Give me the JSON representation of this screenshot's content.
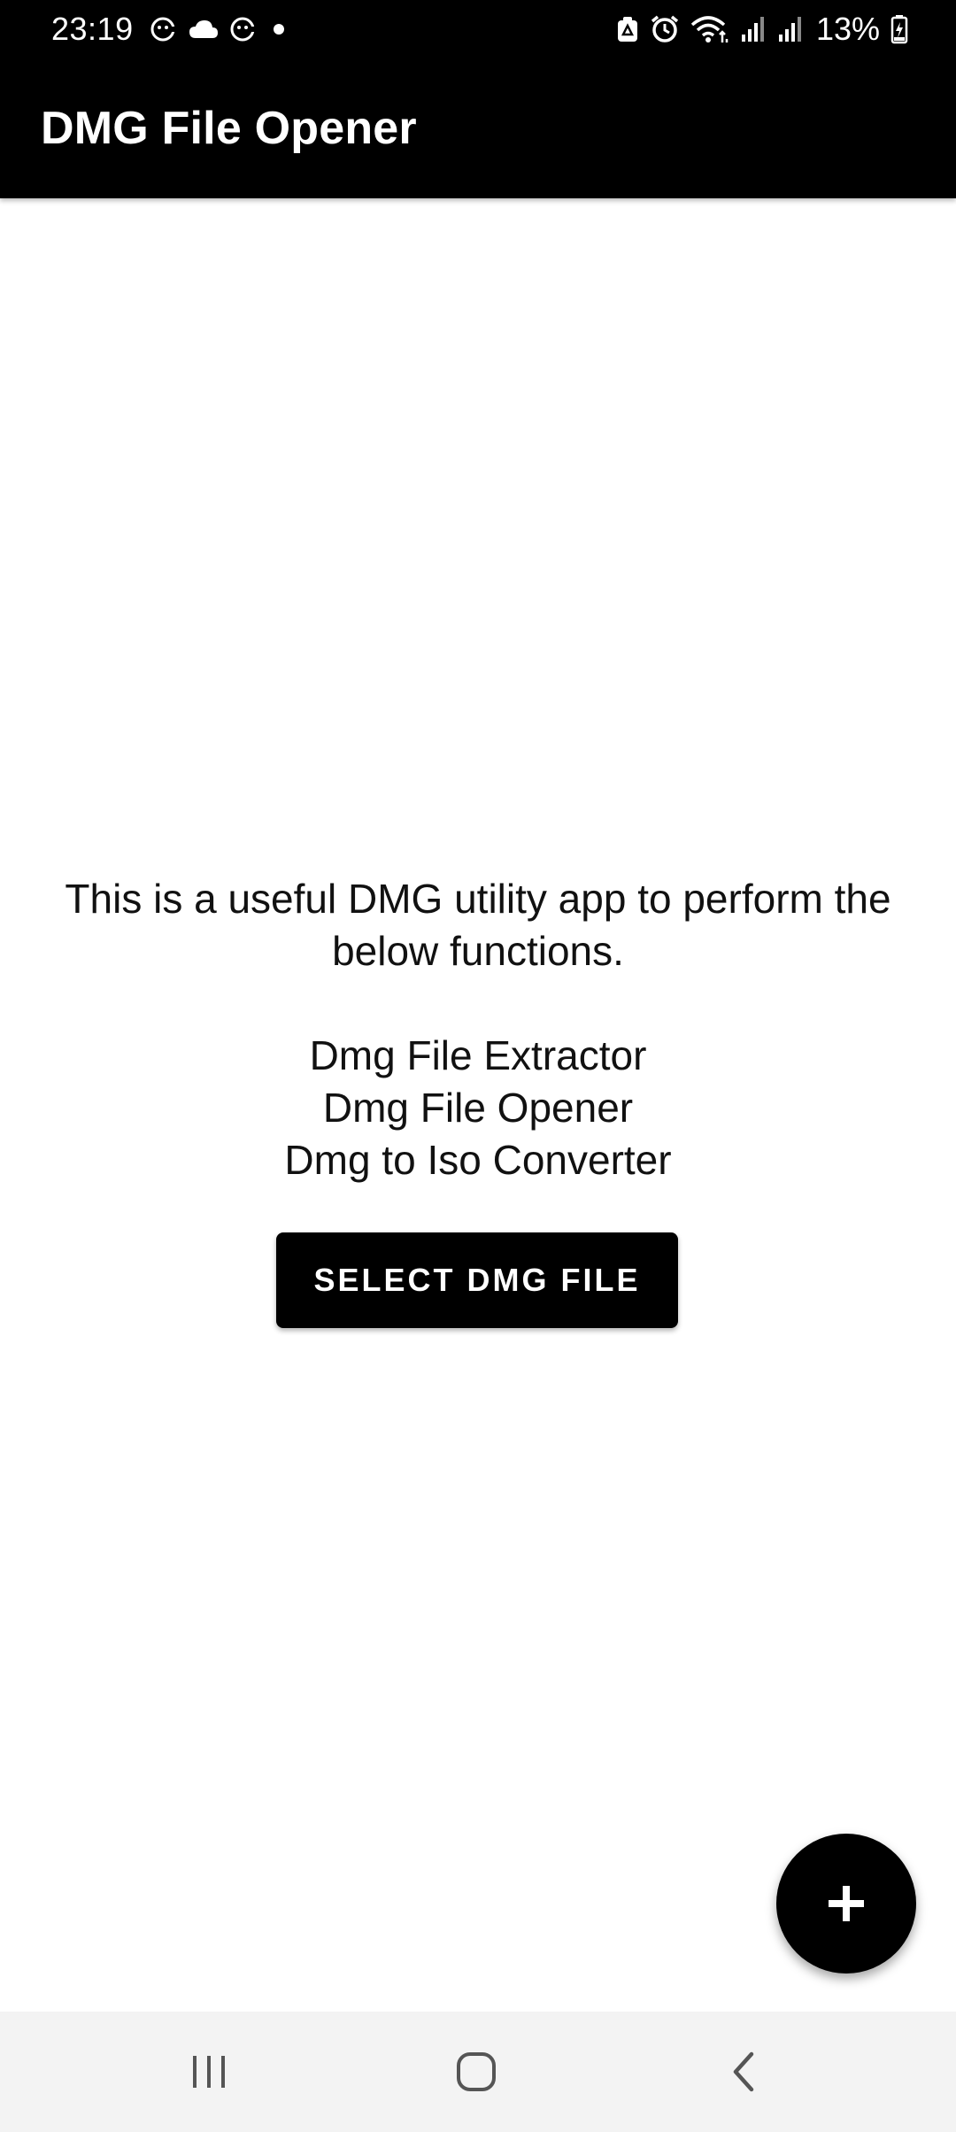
{
  "status_bar": {
    "time": "23:19",
    "battery": "13%",
    "left_icons": [
      "face-icon",
      "cloud-icon",
      "face-icon",
      "dot-icon"
    ],
    "right_icons": [
      "recycle-icon",
      "alarm-icon",
      "wifi-icon",
      "signal-icon",
      "signal-icon",
      "battery-charging-icon"
    ]
  },
  "app_bar": {
    "title": "DMG File Opener"
  },
  "main": {
    "intro": "This is a useful DMG utility app to perform the below functions.",
    "features": [
      "Dmg File Extractor",
      "Dmg File Opener",
      "Dmg to Iso Converter"
    ],
    "select_button_label": "SELECT DMG FILE"
  },
  "fab": {
    "icon": "plus-icon"
  },
  "nav_bar": {
    "buttons": [
      "recents-icon",
      "home-icon",
      "back-icon"
    ]
  },
  "colors": {
    "bar_background": "#000000",
    "page_background": "#ffffff",
    "nav_background": "#f3f3f3"
  }
}
